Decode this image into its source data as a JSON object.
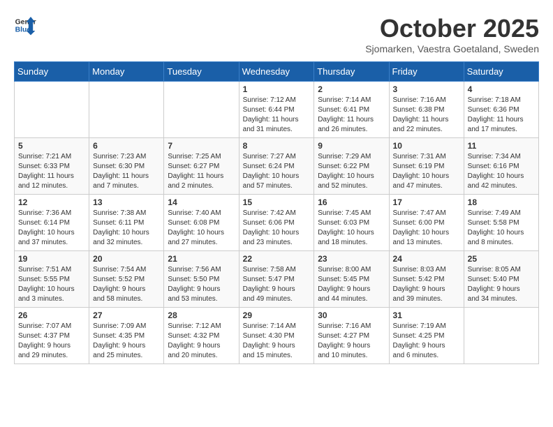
{
  "header": {
    "logo_line1": "General",
    "logo_line2": "Blue",
    "month": "October 2025",
    "location": "Sjomarken, Vaestra Goetaland, Sweden"
  },
  "days_of_week": [
    "Sunday",
    "Monday",
    "Tuesday",
    "Wednesday",
    "Thursday",
    "Friday",
    "Saturday"
  ],
  "weeks": [
    [
      {
        "day": "",
        "info": ""
      },
      {
        "day": "",
        "info": ""
      },
      {
        "day": "",
        "info": ""
      },
      {
        "day": "1",
        "info": "Sunrise: 7:12 AM\nSunset: 6:44 PM\nDaylight: 11 hours\nand 31 minutes."
      },
      {
        "day": "2",
        "info": "Sunrise: 7:14 AM\nSunset: 6:41 PM\nDaylight: 11 hours\nand 26 minutes."
      },
      {
        "day": "3",
        "info": "Sunrise: 7:16 AM\nSunset: 6:38 PM\nDaylight: 11 hours\nand 22 minutes."
      },
      {
        "day": "4",
        "info": "Sunrise: 7:18 AM\nSunset: 6:36 PM\nDaylight: 11 hours\nand 17 minutes."
      }
    ],
    [
      {
        "day": "5",
        "info": "Sunrise: 7:21 AM\nSunset: 6:33 PM\nDaylight: 11 hours\nand 12 minutes."
      },
      {
        "day": "6",
        "info": "Sunrise: 7:23 AM\nSunset: 6:30 PM\nDaylight: 11 hours\nand 7 minutes."
      },
      {
        "day": "7",
        "info": "Sunrise: 7:25 AM\nSunset: 6:27 PM\nDaylight: 11 hours\nand 2 minutes."
      },
      {
        "day": "8",
        "info": "Sunrise: 7:27 AM\nSunset: 6:24 PM\nDaylight: 10 hours\nand 57 minutes."
      },
      {
        "day": "9",
        "info": "Sunrise: 7:29 AM\nSunset: 6:22 PM\nDaylight: 10 hours\nand 52 minutes."
      },
      {
        "day": "10",
        "info": "Sunrise: 7:31 AM\nSunset: 6:19 PM\nDaylight: 10 hours\nand 47 minutes."
      },
      {
        "day": "11",
        "info": "Sunrise: 7:34 AM\nSunset: 6:16 PM\nDaylight: 10 hours\nand 42 minutes."
      }
    ],
    [
      {
        "day": "12",
        "info": "Sunrise: 7:36 AM\nSunset: 6:14 PM\nDaylight: 10 hours\nand 37 minutes."
      },
      {
        "day": "13",
        "info": "Sunrise: 7:38 AM\nSunset: 6:11 PM\nDaylight: 10 hours\nand 32 minutes."
      },
      {
        "day": "14",
        "info": "Sunrise: 7:40 AM\nSunset: 6:08 PM\nDaylight: 10 hours\nand 27 minutes."
      },
      {
        "day": "15",
        "info": "Sunrise: 7:42 AM\nSunset: 6:06 PM\nDaylight: 10 hours\nand 23 minutes."
      },
      {
        "day": "16",
        "info": "Sunrise: 7:45 AM\nSunset: 6:03 PM\nDaylight: 10 hours\nand 18 minutes."
      },
      {
        "day": "17",
        "info": "Sunrise: 7:47 AM\nSunset: 6:00 PM\nDaylight: 10 hours\nand 13 minutes."
      },
      {
        "day": "18",
        "info": "Sunrise: 7:49 AM\nSunset: 5:58 PM\nDaylight: 10 hours\nand 8 minutes."
      }
    ],
    [
      {
        "day": "19",
        "info": "Sunrise: 7:51 AM\nSunset: 5:55 PM\nDaylight: 10 hours\nand 3 minutes."
      },
      {
        "day": "20",
        "info": "Sunrise: 7:54 AM\nSunset: 5:52 PM\nDaylight: 9 hours\nand 58 minutes."
      },
      {
        "day": "21",
        "info": "Sunrise: 7:56 AM\nSunset: 5:50 PM\nDaylight: 9 hours\nand 53 minutes."
      },
      {
        "day": "22",
        "info": "Sunrise: 7:58 AM\nSunset: 5:47 PM\nDaylight: 9 hours\nand 49 minutes."
      },
      {
        "day": "23",
        "info": "Sunrise: 8:00 AM\nSunset: 5:45 PM\nDaylight: 9 hours\nand 44 minutes."
      },
      {
        "day": "24",
        "info": "Sunrise: 8:03 AM\nSunset: 5:42 PM\nDaylight: 9 hours\nand 39 minutes."
      },
      {
        "day": "25",
        "info": "Sunrise: 8:05 AM\nSunset: 5:40 PM\nDaylight: 9 hours\nand 34 minutes."
      }
    ],
    [
      {
        "day": "26",
        "info": "Sunrise: 7:07 AM\nSunset: 4:37 PM\nDaylight: 9 hours\nand 29 minutes."
      },
      {
        "day": "27",
        "info": "Sunrise: 7:09 AM\nSunset: 4:35 PM\nDaylight: 9 hours\nand 25 minutes."
      },
      {
        "day": "28",
        "info": "Sunrise: 7:12 AM\nSunset: 4:32 PM\nDaylight: 9 hours\nand 20 minutes."
      },
      {
        "day": "29",
        "info": "Sunrise: 7:14 AM\nSunset: 4:30 PM\nDaylight: 9 hours\nand 15 minutes."
      },
      {
        "day": "30",
        "info": "Sunrise: 7:16 AM\nSunset: 4:27 PM\nDaylight: 9 hours\nand 10 minutes."
      },
      {
        "day": "31",
        "info": "Sunrise: 7:19 AM\nSunset: 4:25 PM\nDaylight: 9 hours\nand 6 minutes."
      },
      {
        "day": "",
        "info": ""
      }
    ]
  ]
}
